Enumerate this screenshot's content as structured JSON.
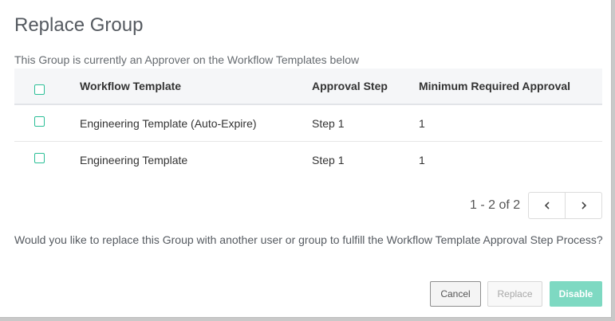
{
  "dialog": {
    "title": "Replace Group",
    "subtitle": "This Group is currently an Approver on the Workflow Templates below",
    "question": "Would you like to replace this Group with another user or group to fulfill the Workflow Template Approval Step Process?"
  },
  "table": {
    "headers": {
      "workflow_template": "Workflow Template",
      "approval_step": "Approval Step",
      "minimum_required_approval": "Minimum Required Approval"
    },
    "rows": [
      {
        "workflow_template": "Engineering Template (Auto-Expire)",
        "approval_step": "Step 1",
        "minimum_required_approval": "1",
        "checked": false
      },
      {
        "workflow_template": "Engineering Template",
        "approval_step": "Step 1",
        "minimum_required_approval": "1",
        "checked": false
      }
    ]
  },
  "pager": {
    "text": "1 - 2 of 2",
    "prev_icon": "chevron-left-icon",
    "next_icon": "chevron-right-icon"
  },
  "buttons": {
    "cancel": "Cancel",
    "replace": "Replace",
    "disable": "Disable"
  },
  "colors": {
    "accent": "#2bbf97",
    "disable_button": "#7ed9c2"
  }
}
